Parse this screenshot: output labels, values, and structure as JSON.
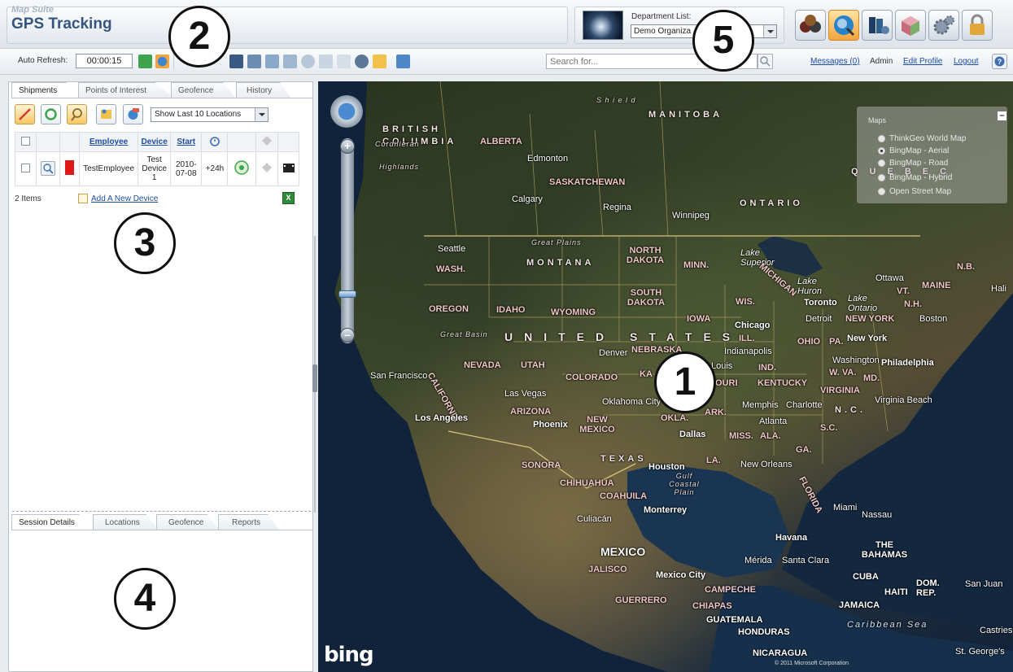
{
  "header": {
    "brand_top": "Map Suite",
    "brand_main": "GPS Tracking",
    "department_label": "Department List:",
    "department_value": "Demo Organiza"
  },
  "toolbar": {
    "auto_refresh_label": "Auto Refresh:",
    "auto_refresh_value": "00:00:15",
    "search_placeholder": "Search for...",
    "messages_link": "Messages (0)",
    "user_name": "Admin",
    "edit_profile_link": "Edit Profile",
    "logout_link": "Logout"
  },
  "left_tabs": [
    "Shipments",
    "Points of Interest",
    "Geofence",
    "History"
  ],
  "location_select": "Show Last 10 Locations",
  "grid": {
    "headers": {
      "employee": "Employee",
      "device": "Device",
      "start": "Start"
    },
    "row": {
      "employee": "TestEmployee",
      "device": "Test Device 1",
      "start": "2010-07-08",
      "duration": "+24h"
    }
  },
  "items_count": "2 Items",
  "add_device_link": "Add A New Device",
  "bottom_tabs": [
    "Session Details",
    "Locations",
    "Geofence",
    "Reports"
  ],
  "callouts": [
    "1",
    "2",
    "3",
    "4",
    "5"
  ],
  "map": {
    "layers_title": "Maps",
    "layer_options": [
      "ThinkGeo World Map",
      "BingMap - Aerial",
      "BingMap - Road",
      "BingMap - Hybrid",
      "Open Street Map"
    ],
    "selected_layer": "BingMap - Aerial",
    "provider_logo": "bing",
    "copyright": "© 2011 Microsoft Corporation",
    "labels": {
      "british_columbia": "BRITISH COLUMBIA",
      "manitoba": "MANITOBA",
      "shield": "S h i e l d",
      "cordilleran": "Cordilleran",
      "highlands": "Highlands",
      "alberta": "ALBERTA",
      "edmonton": "Edmonton",
      "saskatchewan": "SASKATCHEWAN",
      "calgary": "Calgary",
      "regina": "Regina",
      "winnipeg": "Winnipeg",
      "ontario": "ONTARIO",
      "great_plains": "Great Plains",
      "seattle": "Seattle",
      "wash": "WASH.",
      "montana": "MONTANA",
      "north_dakota": "NORTH DAKOTA",
      "minn": "MINN.",
      "lake_superior": "Lake Superior",
      "michigan": "MICHIGAN",
      "oregon": "OREGON",
      "idaho": "IDAHO",
      "wyoming": "WYOMING",
      "south_dakota": "SOUTH DAKOTA",
      "wis": "WIS.",
      "toronto": "Toronto",
      "ottawa": "Ottawa",
      "maine": "MAINE",
      "vt": "VT.",
      "nh": "N.H.",
      "nb": "N.B.",
      "boston": "Boston",
      "new_york": "NEW YORK",
      "new_york_city": "New York",
      "detroit": "Detroit",
      "chicago": "Chicago",
      "iowa": "IOWA",
      "great_basin": "Great Basin",
      "united_states": "UNITED STATES",
      "ill": "ILL.",
      "ind": "IND.",
      "ohio": "OHIO",
      "pa": "PA.",
      "philadelphia": "Philadelphia",
      "washington": "Washington",
      "wva": "W. VA.",
      "md": "MD.",
      "denver": "Denver",
      "nebraska": "NEBRASKA",
      "indianapolis": "Indianapolis",
      "san_francisco": "San Francisco",
      "nevada": "NEVADA",
      "utah": "UTAH",
      "colorado": "COLORADO",
      "kentucky": "KENTUCKY",
      "virginia": "VIRGINIA",
      "virginia_beach": "Virginia Beach",
      "california": "CALIFORNIA",
      "las_vegas": "Las Vegas",
      "oklahoma_city": "Oklahoma City",
      "memphis": "Memphis",
      "charlotte": "Charlotte",
      "nc": "N.C.",
      "sc": "S.C.",
      "atlanta": "Atlanta",
      "los_angeles": "Los Angeles",
      "arizona": "ARIZONA",
      "phoenix": "Phoenix",
      "new_mexico": "NEW MEXICO",
      "okla": "OKLA.",
      "ark": "ARK.",
      "dallas": "Dallas",
      "miss": "MISS.",
      "ala": "ALA.",
      "ga": "GA.",
      "texas": "TEXAS",
      "houston": "Houston",
      "la": "LA.",
      "new_orleans": "New Orleans",
      "florida": "FLORIDA",
      "sonora": "SONORA",
      "chihuahua": "CHIHUAHUA",
      "coahuila": "COAHUILA",
      "gulf_coastal_plain": "Gulf Coastal Plain",
      "monterrey": "Monterrey",
      "culiacan": "Culiacán",
      "miami": "Miami",
      "nassau": "Nassau",
      "havana": "Havana",
      "the_bahamas": "THE BAHAMAS",
      "mexico": "MEXICO",
      "merida": "Mérida",
      "santa_clara": "Santa Clara",
      "jalisco": "JALISCO",
      "mexico_city": "Mexico City",
      "cuba": "CUBA",
      "haiti": "HAITI",
      "dom_rep": "DOM. REP.",
      "san_juan": "San Juan",
      "campeche": "CAMPECHE",
      "guerrero": "GUERRERO",
      "chiapas": "CHIAPAS",
      "jamaica": "JAMAICA",
      "guatemala": "GUATEMALA",
      "honduras": "HONDURAS",
      "caribbean_sea": "Caribbean Sea",
      "castries": "Castries",
      "nicaragua": "NICARAGUA",
      "st_georges": "St. George's",
      "quebec": "QUEBEC",
      "halifax": "Hali",
      "lake_huron": "Lake Huron",
      "lake_ontario": "Lake Ontario",
      "kansas": "KA",
      "missouri": "OURI",
      "louis": "Louis"
    }
  },
  "colors": {
    "brand": "#35557e",
    "link": "#1b4ea3",
    "tool_accent": "#f6c763",
    "active_toolbar": "#f4a53b"
  }
}
